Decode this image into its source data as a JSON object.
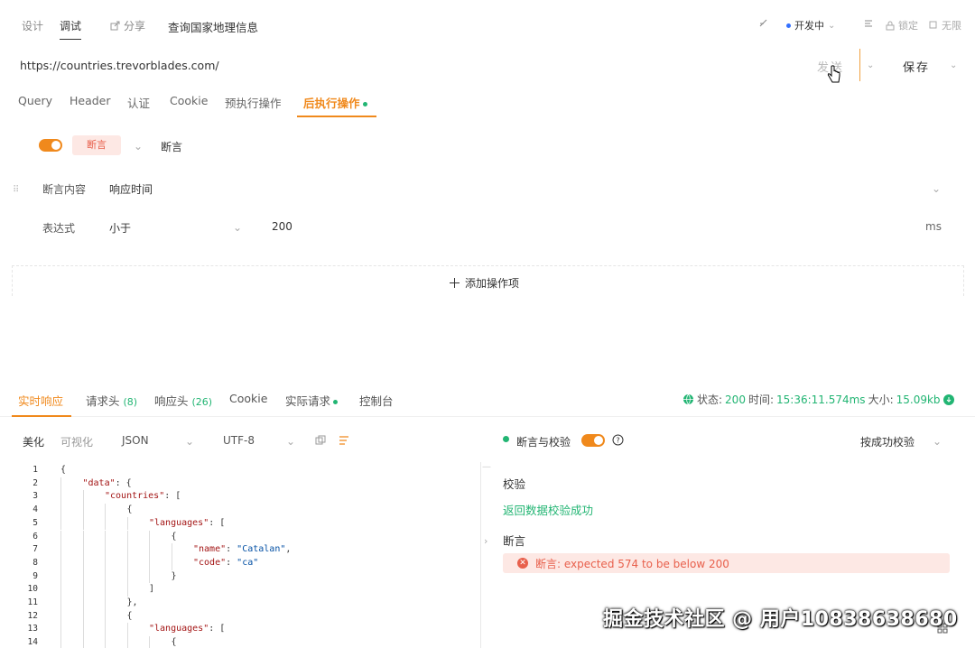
{
  "top": {
    "tab_design": "设计",
    "tab_debug": "调试",
    "share": "分享",
    "api_title": "查询国家地理信息",
    "env": "开发中",
    "lock": "锁定",
    "fullscreen": "无限"
  },
  "url_row": {
    "url": "https://countries.trevorblades.com/",
    "send": "发送",
    "save": "保存"
  },
  "req_tabs": [
    "Query",
    "Header",
    "认证",
    "Cookie",
    "预执行操作",
    "后执行操作"
  ],
  "assertion": {
    "badge": "断言",
    "name": "断言",
    "content_label": "断言内容",
    "content_value": "响应时间",
    "expr_label": "表达式",
    "expr_value": "小于",
    "threshold": "200",
    "unit": "ms",
    "add_label": "添加操作项"
  },
  "resp_tabs": {
    "realtime": "实时响应",
    "req_headers": "请求头",
    "req_headers_count": "(8)",
    "resp_headers": "响应头",
    "resp_headers_count": "(26)",
    "cookie": "Cookie",
    "actual_request": "实际请求",
    "console": "控制台"
  },
  "status": {
    "status_label": "状态:",
    "status_value": "200",
    "time_label": "时间:",
    "time_value": "15:36:11.574ms",
    "size_label": "大小:",
    "size_value": "15.09kb"
  },
  "code_toolbar": {
    "beautify": "美化",
    "visual": "可视化",
    "format": "JSON",
    "encoding": "UTF-8"
  },
  "code_lines": [
    {
      "n": "1",
      "indent": 0,
      "parts": [
        {
          "t": "{",
          "c": "p"
        }
      ]
    },
    {
      "n": "2",
      "indent": 1,
      "parts": [
        {
          "t": "\"data\"",
          "c": "key"
        },
        {
          "t": ": {",
          "c": "p"
        }
      ]
    },
    {
      "n": "3",
      "indent": 2,
      "parts": [
        {
          "t": "\"countries\"",
          "c": "key"
        },
        {
          "t": ": [",
          "c": "p"
        }
      ]
    },
    {
      "n": "4",
      "indent": 3,
      "parts": [
        {
          "t": "{",
          "c": "p"
        }
      ]
    },
    {
      "n": "5",
      "indent": 4,
      "parts": [
        {
          "t": "\"languages\"",
          "c": "key"
        },
        {
          "t": ": [",
          "c": "p"
        }
      ]
    },
    {
      "n": "6",
      "indent": 5,
      "parts": [
        {
          "t": "{",
          "c": "p"
        }
      ]
    },
    {
      "n": "7",
      "indent": 6,
      "parts": [
        {
          "t": "\"name\"",
          "c": "key"
        },
        {
          "t": ": ",
          "c": "p"
        },
        {
          "t": "\"Catalan\"",
          "c": "str"
        },
        {
          "t": ",",
          "c": "p"
        }
      ]
    },
    {
      "n": "8",
      "indent": 6,
      "parts": [
        {
          "t": "\"code\"",
          "c": "key"
        },
        {
          "t": ": ",
          "c": "p"
        },
        {
          "t": "\"ca\"",
          "c": "str"
        }
      ]
    },
    {
      "n": "9",
      "indent": 5,
      "parts": [
        {
          "t": "}",
          "c": "p"
        }
      ]
    },
    {
      "n": "10",
      "indent": 4,
      "parts": [
        {
          "t": "]",
          "c": "p"
        }
      ]
    },
    {
      "n": "11",
      "indent": 3,
      "parts": [
        {
          "t": "},",
          "c": "p"
        }
      ]
    },
    {
      "n": "12",
      "indent": 3,
      "parts": [
        {
          "t": "{",
          "c": "p"
        }
      ]
    },
    {
      "n": "13",
      "indent": 4,
      "parts": [
        {
          "t": "\"languages\"",
          "c": "key"
        },
        {
          "t": ": [",
          "c": "p"
        }
      ]
    },
    {
      "n": "14",
      "indent": 5,
      "parts": [
        {
          "t": "{",
          "c": "p"
        }
      ]
    }
  ],
  "right_panel": {
    "toggle_label": "断言与校验",
    "filter": "按成功校验",
    "validation_title": "校验",
    "validation_result": "返回数据校验成功",
    "assert_title": "断言",
    "assert_error": "断言: expected 574 to be below 200"
  },
  "watermark": "掘金技术社区 @ 用户10838638680",
  "colors": {
    "accent": "#f0891c",
    "success": "#22b573",
    "error": "#e8604c",
    "error_bg": "#fde8e4"
  }
}
